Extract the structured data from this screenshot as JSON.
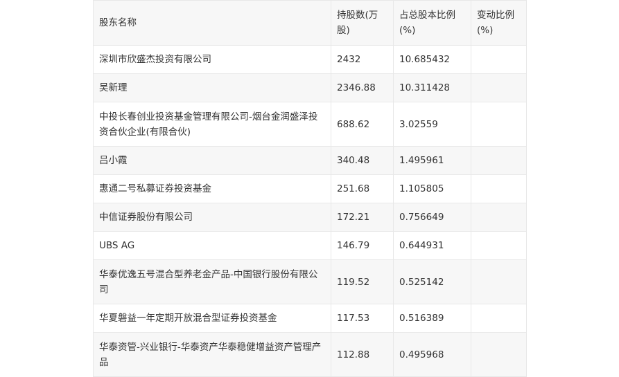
{
  "table": {
    "headers": [
      "股东名称",
      "持股数(万股)",
      "占总股本比例(%)",
      "变动比例(%)"
    ],
    "rows": [
      {
        "name": "深圳市欣盛杰投资有限公司",
        "shares": "2432",
        "ratio": "10.685432",
        "change": ""
      },
      {
        "name": "吴新理",
        "shares": "2346.88",
        "ratio": "10.311428",
        "change": ""
      },
      {
        "name": "中投长春创业投资基金管理有限公司-烟台金润盛泽投资合伙企业(有限合伙)",
        "shares": "688.62",
        "ratio": "3.02559",
        "change": ""
      },
      {
        "name": "吕小霞",
        "shares": "340.48",
        "ratio": "1.495961",
        "change": ""
      },
      {
        "name": "惠通二号私募证券投资基金",
        "shares": "251.68",
        "ratio": "1.105805",
        "change": ""
      },
      {
        "name": "中信证券股份有限公司",
        "shares": "172.21",
        "ratio": "0.756649",
        "change": ""
      },
      {
        "name": "UBS AG",
        "shares": "146.79",
        "ratio": "0.644931",
        "change": ""
      },
      {
        "name": "华泰优逸五号混合型养老金产品-中国银行股份有限公司",
        "shares": "119.52",
        "ratio": "0.525142",
        "change": ""
      },
      {
        "name": "华夏磐益一年定期开放混合型证券投资基金",
        "shares": "117.53",
        "ratio": "0.516389",
        "change": ""
      },
      {
        "name": "华泰资管-兴业银行-华泰资产华泰稳健增益资产管理产品",
        "shares": "112.88",
        "ratio": "0.495968",
        "change": ""
      }
    ]
  }
}
